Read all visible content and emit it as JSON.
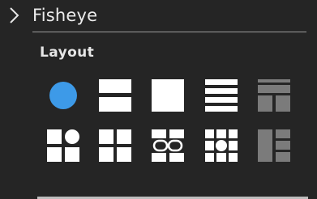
{
  "panel": {
    "section_title": "Fisheye",
    "group_label": "Layout"
  },
  "layouts": [
    {
      "name": "layout-single-circle-icon",
      "state": "selected",
      "color": "#3d9ae8"
    },
    {
      "name": "layout-two-rows-icon",
      "state": "enabled"
    },
    {
      "name": "layout-single-square-icon",
      "state": "enabled"
    },
    {
      "name": "layout-four-rows-icon",
      "state": "enabled"
    },
    {
      "name": "layout-one-top-two-bottom-icon",
      "state": "disabled"
    },
    {
      "name": "layout-quad-with-circle-icon",
      "state": "enabled"
    },
    {
      "name": "layout-quad-icon",
      "state": "enabled"
    },
    {
      "name": "layout-quad-linked-icon",
      "state": "enabled"
    },
    {
      "name": "layout-nine-with-circle-icon",
      "state": "enabled"
    },
    {
      "name": "layout-one-large-two-right-icon",
      "state": "disabled"
    }
  ],
  "colors": {
    "background": "#252525",
    "icon_enabled": "#ffffff",
    "icon_disabled": "#7b7b7b",
    "selected": "#3d9ae8"
  }
}
